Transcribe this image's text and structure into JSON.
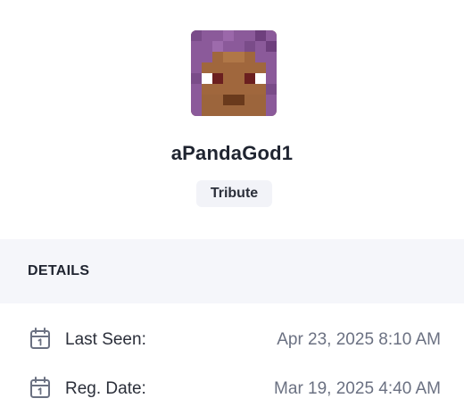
{
  "profile": {
    "username": "aPandaGod1",
    "rank_badge": "Tribute",
    "avatar_icon": "minecraft-skin-face"
  },
  "details": {
    "title": "DETAILS",
    "rows": [
      {
        "label": "Last Seen:",
        "value": "Apr 23, 2025 8:10 AM",
        "icon": "calendar-icon"
      },
      {
        "label": "Reg. Date:",
        "value": "Mar 19, 2025 4:40 AM",
        "icon": "calendar-icon"
      }
    ]
  },
  "colors": {
    "hair": "#8b5a9a",
    "skin": "#a0673d",
    "eyes": "#6b1f1f",
    "mouth": "#6a3a1c",
    "details_background": "#f5f6fa",
    "badge_background": "#f2f3f8"
  }
}
